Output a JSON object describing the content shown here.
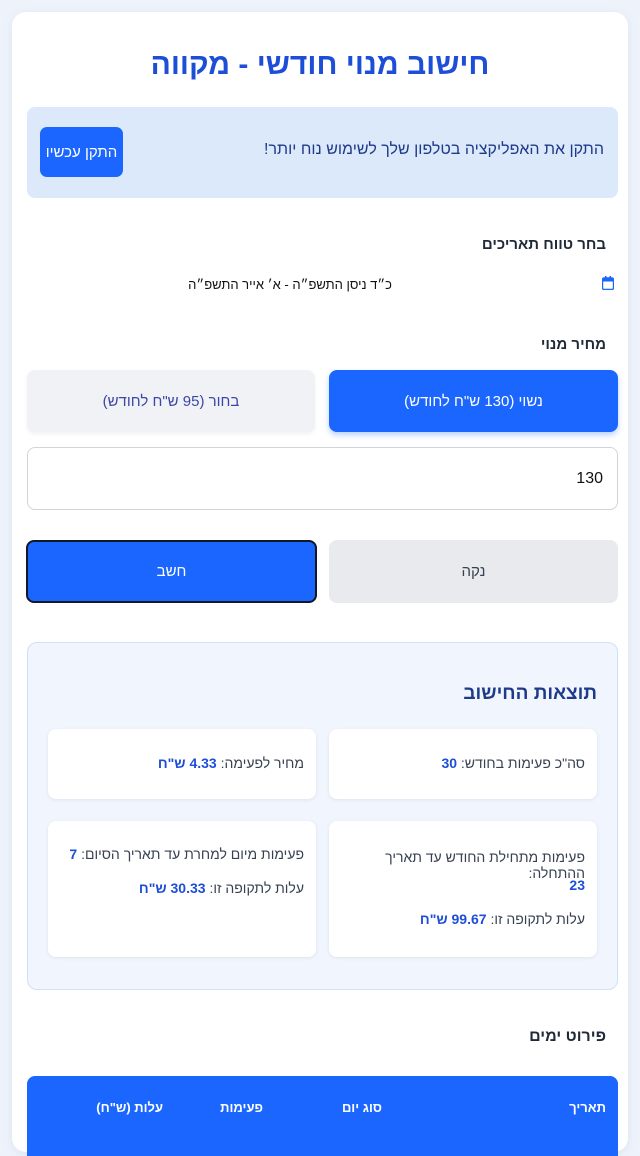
{
  "page": {
    "title": "חישוב מנוי חודשי - מקווה"
  },
  "install": {
    "text": "התקן את האפליקציה בטלפון שלך לשימוש נוח יותר!",
    "button": "התקן עכשיו"
  },
  "date_range": {
    "label": "בחר טווח תאריכים",
    "value": "כ״ד ניסן התשפ״ה - א׳ אייר התשפ״ה",
    "icon": "calendar-icon"
  },
  "price": {
    "label": "מחיר מנוי",
    "option_married": "נשוי (130 ש\"ח לחודש)",
    "option_single": "בחור (95 ש\"ח לחודש)",
    "input_value": "130"
  },
  "actions": {
    "clear": "נקה",
    "calculate": "חשב"
  },
  "results": {
    "title": "תוצאות החישוב",
    "total_label": "סה\"כ פעימות בחודש:",
    "total_value": "30",
    "per_label": "מחיר לפעימה:",
    "per_value": "4.33 ש\"ח",
    "start_label": "פעימות מתחילת החודש עד תאריך ההתחלה:",
    "start_value": "23",
    "start_cost_label": "עלות לתקופה זו:",
    "start_cost_value": "99.67 ש\"ח",
    "end_label": "פעימות מיום למחרת עד תאריך הסיום:",
    "end_value": "7",
    "end_cost_label": "עלות לתקופה זו:",
    "end_cost_value": "30.33 ש\"ח"
  },
  "breakdown": {
    "title": "פירוט ימים",
    "columns": [
      "תאריך",
      "סוג יום",
      "פעימות",
      "עלות (ש\"ח)"
    ]
  },
  "colors": {
    "accent": "#1a66ff",
    "title": "#1d4ed8",
    "banner": "#dce9fb"
  }
}
